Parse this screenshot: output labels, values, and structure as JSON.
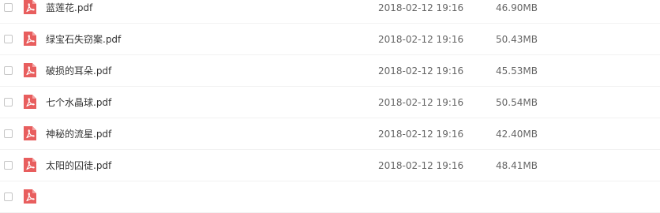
{
  "file_list": {
    "rows": [
      {
        "name": "蓝莲花.pdf",
        "modified": "2018-02-12 19:16",
        "size": "46.90MB",
        "icon": "pdf-file-icon"
      },
      {
        "name": "绿宝石失窃案.pdf",
        "modified": "2018-02-12 19:16",
        "size": "50.43MB",
        "icon": "pdf-file-icon"
      },
      {
        "name": "破损的耳朵.pdf",
        "modified": "2018-02-12 19:16",
        "size": "45.53MB",
        "icon": "pdf-file-icon"
      },
      {
        "name": "七个水晶球.pdf",
        "modified": "2018-02-12 19:16",
        "size": "50.54MB",
        "icon": "pdf-file-icon"
      },
      {
        "name": "神秘的流星.pdf",
        "modified": "2018-02-12 19:16",
        "size": "42.40MB",
        "icon": "pdf-file-icon"
      },
      {
        "name": "太阳的囚徒.pdf",
        "modified": "2018-02-12 19:16",
        "size": "48.41MB",
        "icon": "pdf-file-icon"
      },
      {
        "name": "",
        "modified": "",
        "size": "",
        "icon": "pdf-file-icon"
      }
    ]
  },
  "colors": {
    "pdf_icon": "#e85e5e",
    "text": "#333333",
    "meta_text": "#666666",
    "checkbox_border": "#c5c5c5"
  }
}
